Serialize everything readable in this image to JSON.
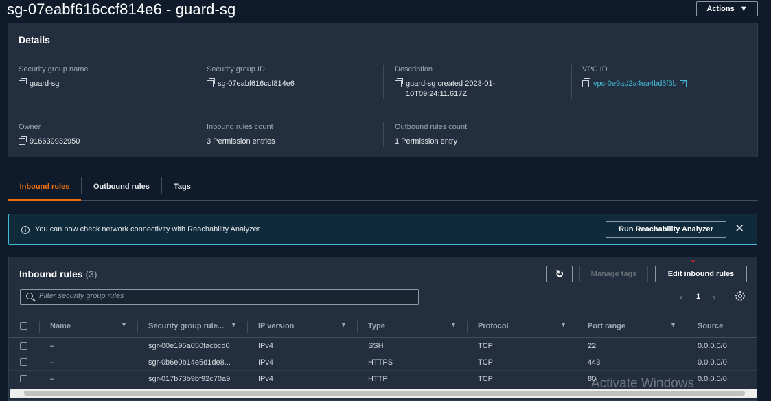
{
  "page_title": "sg-07eabf616ccf814e6 - guard-sg",
  "actions_label": "Actions",
  "details": {
    "heading": "Details",
    "fields": {
      "sg_name": {
        "label": "Security group name",
        "value": "guard-sg"
      },
      "sg_id": {
        "label": "Security group ID",
        "value": "sg-07eabf616ccf814e6"
      },
      "description": {
        "label": "Description",
        "value_line1": "guard-sg created 2023-01-",
        "value_line2": "10T09:24:11.617Z"
      },
      "vpc_id": {
        "label": "VPC ID",
        "value": "vpc-0e9ad2a4ea4bd5f3b"
      },
      "owner": {
        "label": "Owner",
        "value": "916639932950"
      },
      "inbound_count": {
        "label": "Inbound rules count",
        "value": "3 Permission entries"
      },
      "outbound_count": {
        "label": "Outbound rules count",
        "value": "1 Permission entry"
      }
    }
  },
  "tabs": [
    "Inbound rules",
    "Outbound rules",
    "Tags"
  ],
  "banner": {
    "text": "You can now check network connectivity with Reachability Analyzer",
    "button": "Run Reachability Analyzer"
  },
  "rules": {
    "title": "Inbound rules",
    "count": "(3)",
    "manage_tags": "Manage tags",
    "edit_inbound": "Edit inbound rules",
    "filter_placeholder": "Filter security group rules",
    "page": "1",
    "columns": [
      "Name",
      "Security group rule...",
      "IP version",
      "Type",
      "Protocol",
      "Port range",
      "Source"
    ],
    "rows": [
      {
        "name": "–",
        "rule_id": "sgr-00e195a050facbcd0",
        "ip": "IPv4",
        "type": "SSH",
        "protocol": "TCP",
        "port": "22",
        "source": "0.0.0.0/0"
      },
      {
        "name": "–",
        "rule_id": "sgr-0b6e0b14e5d1de8...",
        "ip": "IPv4",
        "type": "HTTPS",
        "protocol": "TCP",
        "port": "443",
        "source": "0.0.0.0/0"
      },
      {
        "name": "–",
        "rule_id": "sgr-017b73b9bf92c70a9",
        "ip": "IPv4",
        "type": "HTTP",
        "protocol": "TCP",
        "port": "80",
        "source": "0.0.0.0/0"
      }
    ]
  },
  "watermark": "Activate Windows",
  "colors": {
    "accent": "#ec7211",
    "link": "#44b9d6",
    "panel": "#232f3e",
    "background": "#0f1b2a",
    "annotation_arrow": "#e0281f"
  }
}
